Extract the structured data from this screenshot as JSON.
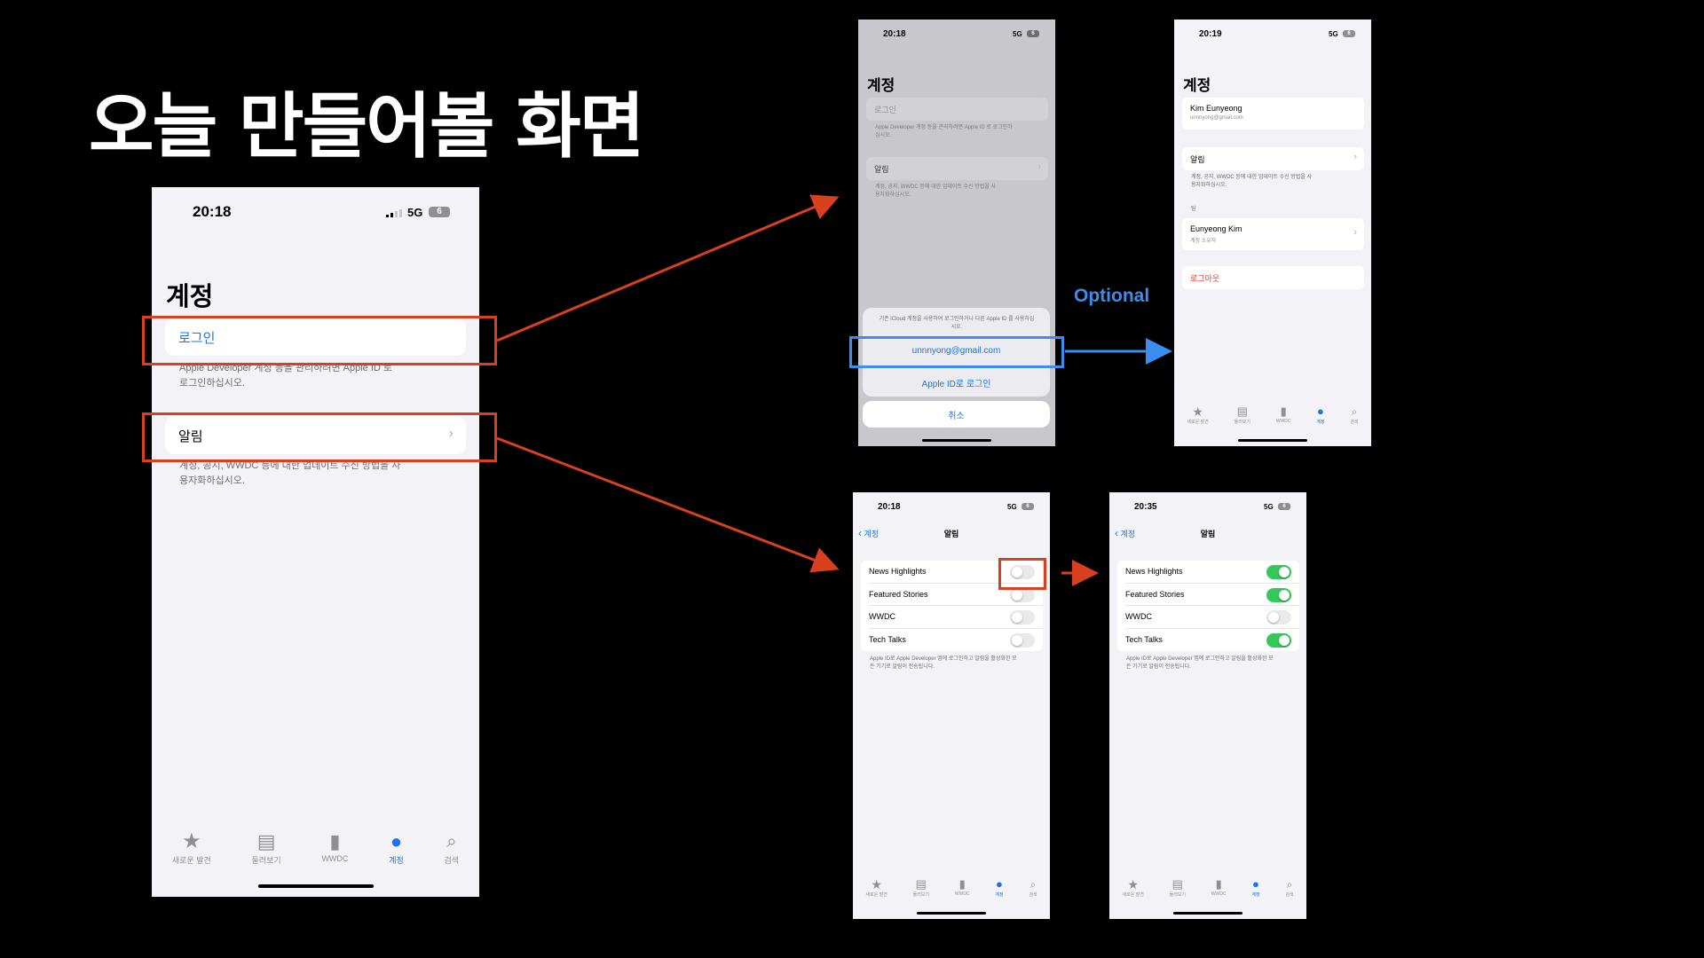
{
  "slide": {
    "title": "오늘 만들어볼 화면",
    "optional_label": "Optional"
  },
  "common": {
    "network": "5G",
    "battery": "6",
    "tabs": [
      "새로운 발견",
      "둘러보기",
      "WWDC",
      "계정",
      "검색"
    ]
  },
  "main_phone": {
    "time": "20:18",
    "header": "계정",
    "login_label": "로그인",
    "login_note": "Apple Developer 계정 등을 관리하려면 Apple ID 로 로그인하십시오.",
    "notify_label": "알림",
    "notify_note": "계정, 공지, WWDC 등에 대한 업데이트 수신 방법을 사용자화하십시오."
  },
  "login_sheet_phone": {
    "time": "20:18",
    "header": "계정",
    "login_label": "로그인",
    "login_note": "Apple Developer 계정 등을 관리하려면 Apple ID 로 로그인하십시오.",
    "notify_label": "알림",
    "notify_note": "계정, 공지, WWDC 등에 대한 업데이트 수신 방법을 사용자화하십시오.",
    "sheet_note": "기존 iCloud 계정을 사용하여 로그인하거나 다른 Apple ID 를 사용하십시오.",
    "email_button": "unnnyong@gmail.com",
    "appleid_button": "Apple ID로 로그인",
    "cancel_button": "취소"
  },
  "account_phone": {
    "time": "20:19",
    "header": "계정",
    "name": "Kim Eunyeong",
    "email": "unnnyong@gmail.com",
    "notify_label": "알림",
    "notify_note": "계정, 공지, WWDC 등에 대한 업데이트 수신 방법을 사용자화하십시오.",
    "team_header": "팀",
    "team_name": "Eunyeong Kim",
    "team_role": "계정 소유자",
    "logout_label": "로그아웃"
  },
  "notify_phone_off": {
    "time": "20:18",
    "back_label": "계정",
    "nav_title": "알림",
    "items": [
      {
        "label": "News Highlights",
        "on": false
      },
      {
        "label": "Featured Stories",
        "on": false
      },
      {
        "label": "WWDC",
        "on": false
      },
      {
        "label": "Tech Talks",
        "on": false
      }
    ],
    "note": "Apple ID로 Apple Developer 앱에 로그인하고 알림을 활성화한 모든 기기로 알림이 전송됩니다."
  },
  "notify_phone_on": {
    "time": "20:35",
    "back_label": "계정",
    "nav_title": "알림",
    "items": [
      {
        "label": "News Highlights",
        "on": true
      },
      {
        "label": "Featured Stories",
        "on": true
      },
      {
        "label": "WWDC",
        "on": false
      },
      {
        "label": "Tech Talks",
        "on": true
      }
    ],
    "note": "Apple ID로 Apple Developer 앱에 로그인하고 알림을 활성화한 모든 기기로 알림이 전송됩니다."
  },
  "colors": {
    "accent_red": "#d9401f",
    "accent_blue": "#3b8df0",
    "toggle_on": "#34c759"
  }
}
